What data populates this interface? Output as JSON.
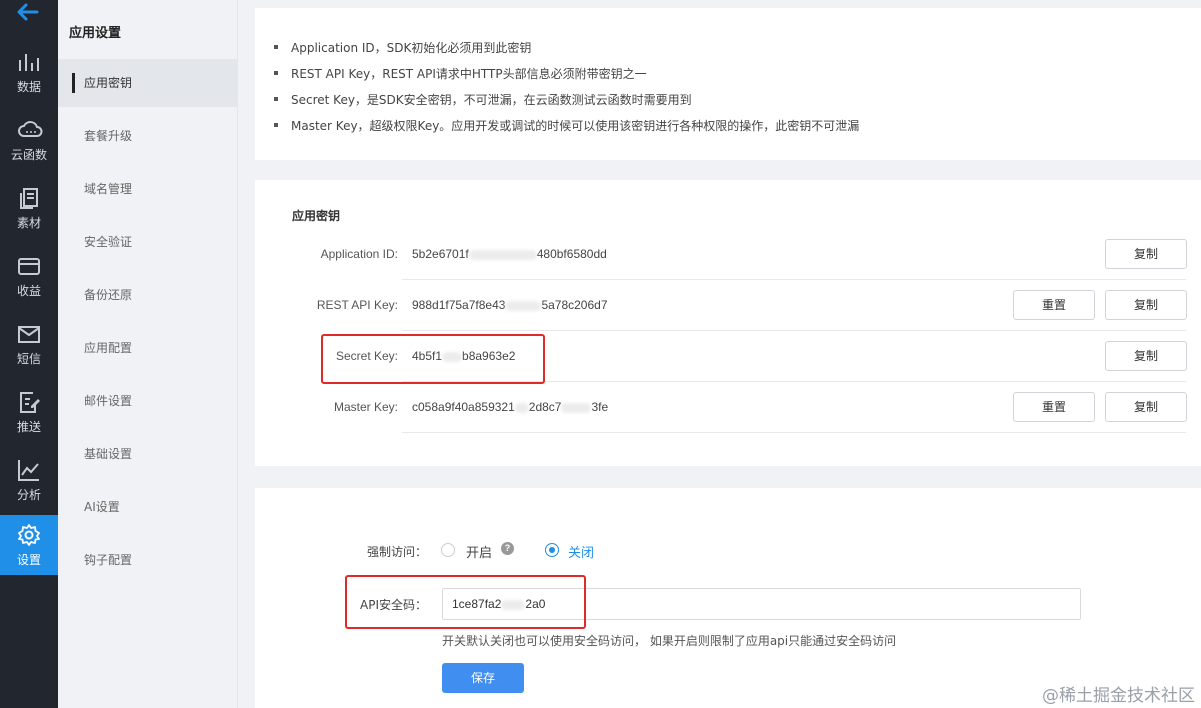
{
  "sidebar": {
    "back_icon": "arrow-left-icon",
    "items": [
      {
        "label": "数据",
        "icon": "bar-chart-icon"
      },
      {
        "label": "云函数",
        "icon": "cloud-icon"
      },
      {
        "label": "素材",
        "icon": "files-icon"
      },
      {
        "label": "收益",
        "icon": "card-icon"
      },
      {
        "label": "短信",
        "icon": "mail-icon"
      },
      {
        "label": "推送",
        "icon": "edit-icon"
      },
      {
        "label": "分析",
        "icon": "line-chart-icon"
      },
      {
        "label": "设置",
        "icon": "gear-icon",
        "active": true
      }
    ],
    "accent": "#1f8fe8"
  },
  "subnav": {
    "title": "应用设置",
    "items": [
      "应用密钥",
      "套餐升级",
      "域名管理",
      "安全验证",
      "备份还原",
      "应用配置",
      "邮件设置",
      "基础设置",
      "AI设置",
      "钩子配置"
    ]
  },
  "info": {
    "bullets": [
      "Application ID，SDK初始化必须用到此密钥",
      "REST API Key，REST API请求中HTTP头部信息必须附带密钥之一",
      "Secret Key，是SDK安全密钥，不可泄漏，在云函数测试云函数时需要用到",
      "Master Key，超级权限Key。应用开发或调试的时候可以使用该密钥进行各种权限的操作，此密钥不可泄漏"
    ]
  },
  "keys": {
    "title": "应用密钥",
    "rows": [
      {
        "label": "Application ID:",
        "value_start": "5b2e6701f",
        "value_end": "480bf6580dd",
        "copy": "复制"
      },
      {
        "label": "REST API Key:",
        "value_start": "988d1f75a7f8e43",
        "value_end": "5a78c206d7",
        "reset": "重置",
        "copy": "复制"
      },
      {
        "label": "Secret Key:",
        "value_start": "4b5f1",
        "value_end": "b8a963e2",
        "copy": "复制"
      },
      {
        "label": "Master Key:",
        "value_start": "c058a9f40a859321",
        "value_end": "2d8c7",
        "value_tail": "3fe",
        "reset": "重置",
        "copy": "复制"
      }
    ]
  },
  "security": {
    "force_label": "强制访问：",
    "option_on": "开启",
    "option_off": "关闭",
    "selected": "关闭",
    "apikey_label": "API安全码：",
    "apikey_start": "1ce87fa2",
    "apikey_end": "2a0",
    "hint": "开关默认关闭也可以使用安全码访问， 如果开启则限制了应用api只能通过安全码访问",
    "save": "保存"
  },
  "watermark": "@稀土掘金技术社区"
}
